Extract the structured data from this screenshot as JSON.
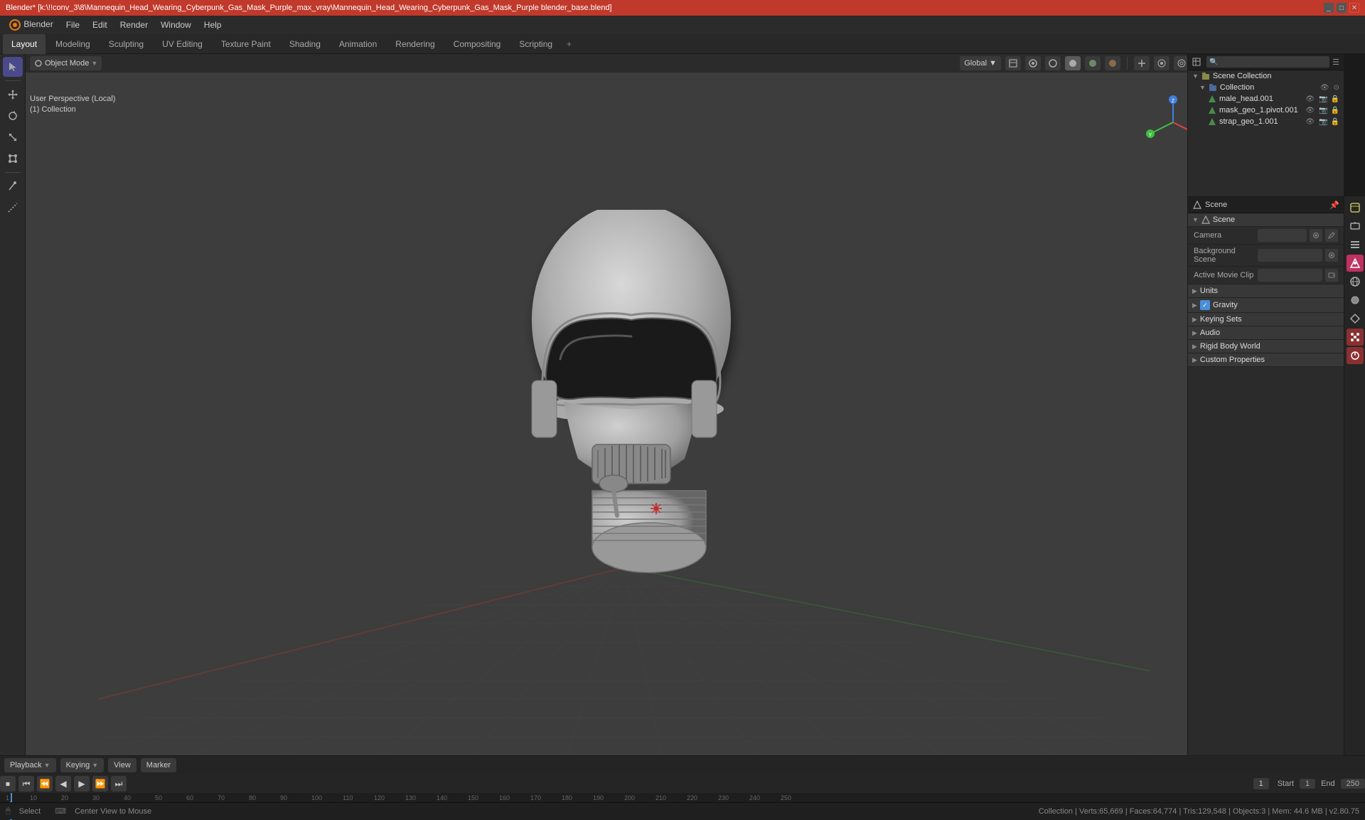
{
  "window": {
    "title": "Blender* [k:\\!!conv_3\\8\\Mannequin_Head_Wearing_Cyberpunk_Gas_Mask_Purple_max_vray\\Mannequin_Head_Wearing_Cyberpunk_Gas_Mask_Purple blender_base.blend]",
    "controls": [
      "_",
      "□",
      "✕"
    ]
  },
  "menu": {
    "items": [
      "Blender",
      "File",
      "Edit",
      "Render",
      "Window",
      "Help"
    ]
  },
  "workspaces": {
    "tabs": [
      "Layout",
      "Modeling",
      "Sculpting",
      "UV Editing",
      "Texture Paint",
      "Shading",
      "Animation",
      "Rendering",
      "Compositing",
      "Scripting"
    ],
    "active": "Layout",
    "add_label": "+"
  },
  "viewport": {
    "mode_label": "Object Mode",
    "global_label": "Global",
    "perspective_line1": "User Perspective (Local)",
    "perspective_line2": "(1) Collection"
  },
  "left_toolbar": {
    "tools": [
      "↖",
      "↔",
      "↻",
      "⊕",
      "⊙",
      "✏",
      "📐"
    ]
  },
  "outliner": {
    "header_label": "Scene Collection",
    "items": [
      {
        "label": "Collection",
        "icon": "📁",
        "indent": 1,
        "has_eye": true
      },
      {
        "label": "male_head.001",
        "icon": "△",
        "indent": 2,
        "has_eye": true
      },
      {
        "label": "mask_geo_1.pivot.001",
        "icon": "△",
        "indent": 2,
        "has_eye": true
      },
      {
        "label": "strap_geo_1.001",
        "icon": "△",
        "indent": 2,
        "has_eye": true
      }
    ]
  },
  "scene_props": {
    "panel_title": "Scene",
    "section_title": "Scene",
    "camera_label": "Camera",
    "camera_value": "",
    "background_scene_label": "Background Scene",
    "background_scene_value": "",
    "active_movie_clip_label": "Active Movie Clip",
    "active_movie_clip_value": "",
    "sections": [
      {
        "label": "Units",
        "collapsed": true
      },
      {
        "label": "Gravity",
        "collapsed": false,
        "has_checkbox": true,
        "checked": true
      },
      {
        "label": "Keying Sets",
        "collapsed": true
      },
      {
        "label": "Audio",
        "collapsed": true
      },
      {
        "label": "Rigid Body World",
        "collapsed": true
      },
      {
        "label": "Custom Properties",
        "collapsed": true
      }
    ]
  },
  "timeline": {
    "header_items": [
      "Playback",
      "Keying",
      "View",
      "Marker"
    ],
    "playback_label": "Playback",
    "keying_label": "Keying",
    "view_label": "View",
    "marker_label": "Marker",
    "controls": [
      "⏹",
      "⏮",
      "⏪",
      "◀",
      "▶",
      "⏩",
      "⏭"
    ],
    "current_frame": "1",
    "start_label": "Start",
    "start_value": "1",
    "end_label": "End",
    "end_value": "250",
    "frame_marks": [
      1,
      10,
      20,
      30,
      40,
      50,
      60,
      70,
      80,
      90,
      100,
      110,
      120,
      130,
      140,
      150,
      160,
      170,
      180,
      190,
      200,
      210,
      220,
      230,
      240,
      250
    ]
  },
  "status_bar": {
    "select_label": "Select",
    "center_label": "Center View to Mouse",
    "collection_info": "Collection | Verts:65,669 | Faces:64,774 | Tris:129,548 | Objects:3 | Mem: 44.6 MB | v2.80.75"
  },
  "prop_icons": {
    "icons": [
      "🎬",
      "📷",
      "🔩",
      "🌐",
      "👁",
      "🎭",
      "💥",
      "🔴",
      "⚙"
    ]
  }
}
